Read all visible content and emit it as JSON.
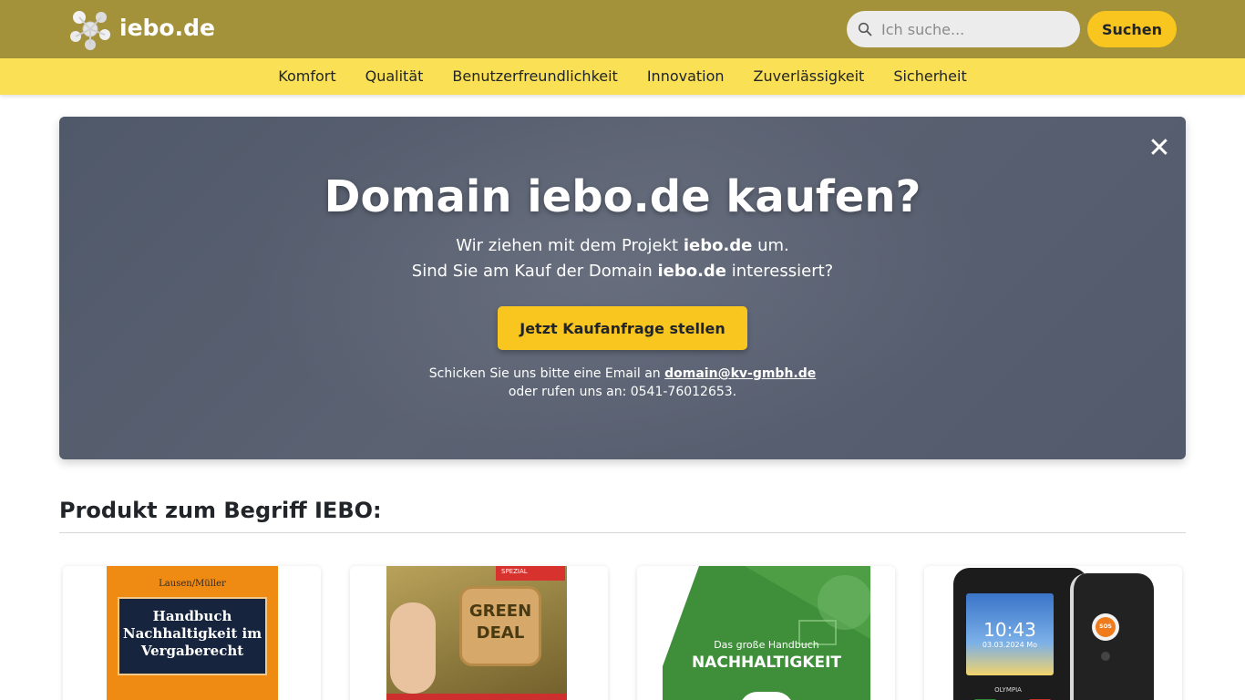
{
  "header": {
    "brand": "iebo.de",
    "search": {
      "placeholder": "Ich suche...",
      "button_label": "Suchen"
    }
  },
  "nav": {
    "items": [
      "Komfort",
      "Qualität",
      "Benutzerfreundlichkeit",
      "Innovation",
      "Zuverlässigkeit",
      "Sicherheit"
    ]
  },
  "hero": {
    "close_glyph": "✕",
    "title": "Domain iebo.de kaufen?",
    "line1": {
      "before": "Wir ziehen mit dem Projekt ",
      "domain": "iebo.de",
      "after": " um."
    },
    "line2": {
      "before": "Sind Sie am Kauf der Domain ",
      "domain": "iebo.de",
      "after": " interessiert?"
    },
    "cta_label": "Jetzt Kaufanfrage stellen",
    "contact_line1_before": "Schicken Sie uns bitte eine Email an ",
    "contact_email": "domain@kv-gmbh.de",
    "contact_line2": "oder rufen uns an: 0541-76012653."
  },
  "products": {
    "title": "Produkt zum Begriff IEBO:",
    "items": [
      {
        "cover_author": "Lausen/Müller",
        "cover_title_1": "Handbuch",
        "cover_title_2": "Nachhaltigkeit im",
        "cover_title_3": "Vergaberecht"
      },
      {
        "cover_badge": "SPEZIAL",
        "cover_word_1": "GREEN",
        "cover_word_2": "DEAL"
      },
      {
        "cover_subtitle": "Das große Handbuch",
        "cover_title": "NACHHALTIGKEIT"
      },
      {
        "time": "10:43",
        "date": "03.03.2024 Mo",
        "brand": "OLYMPIA",
        "sos": "SOS"
      }
    ]
  }
}
